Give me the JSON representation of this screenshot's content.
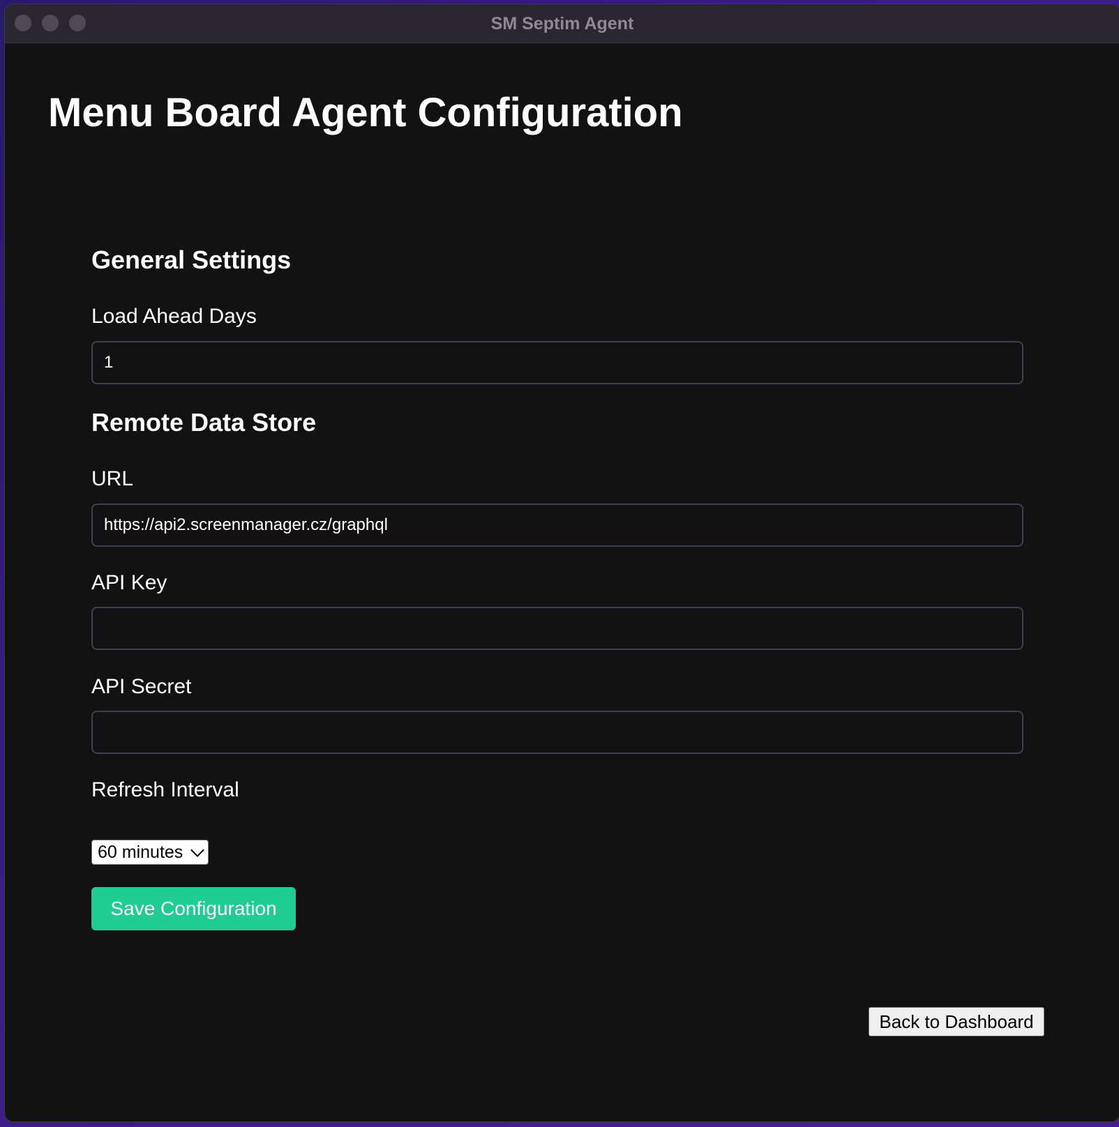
{
  "window": {
    "title": "SM Septim Agent"
  },
  "page": {
    "title": "Menu Board Agent Configuration"
  },
  "general": {
    "heading": "General Settings",
    "load_ahead_label": "Load Ahead Days",
    "load_ahead_value": "1"
  },
  "remote": {
    "heading": "Remote Data Store",
    "url_label": "URL",
    "url_value": "https://api2.screenmanager.cz/graphql",
    "api_key_label": "API Key",
    "api_key_value": "",
    "api_secret_label": "API Secret",
    "api_secret_value": "",
    "refresh_label": "Refresh Interval",
    "refresh_selected": "60 minutes"
  },
  "actions": {
    "save_label": "Save Configuration",
    "back_label": "Back to Dashboard"
  },
  "colors": {
    "accent": "#1fcc91",
    "background": "#121212",
    "input_border": "#3a4350"
  }
}
